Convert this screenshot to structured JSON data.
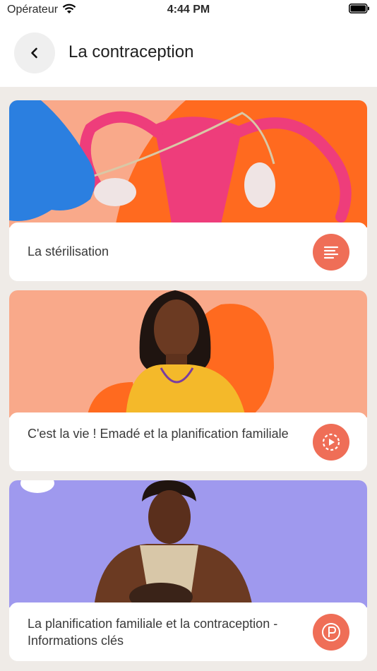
{
  "status_bar": {
    "carrier": "Opérateur",
    "time": "4:44 PM"
  },
  "header": {
    "title": "La contraception",
    "back_icon": "chevron-left-icon"
  },
  "cards": [
    {
      "title": "La stérilisation",
      "icon": "article-icon",
      "accent": "#ef6e57"
    },
    {
      "title": "C'est la vie ! Emadé et la planification familiale",
      "icon": "play-icon",
      "accent": "#ef6e57"
    },
    {
      "title": "La planification familiale et la contraception - Informations clés",
      "icon": "podcast-icon",
      "accent": "#ef6e57"
    }
  ],
  "colors": {
    "orange": "#ff6a1f",
    "peach": "#f9a98a",
    "lavender": "#9f99ee",
    "pink": "#ef3e7a",
    "glove_blue": "#2b7fe0"
  }
}
